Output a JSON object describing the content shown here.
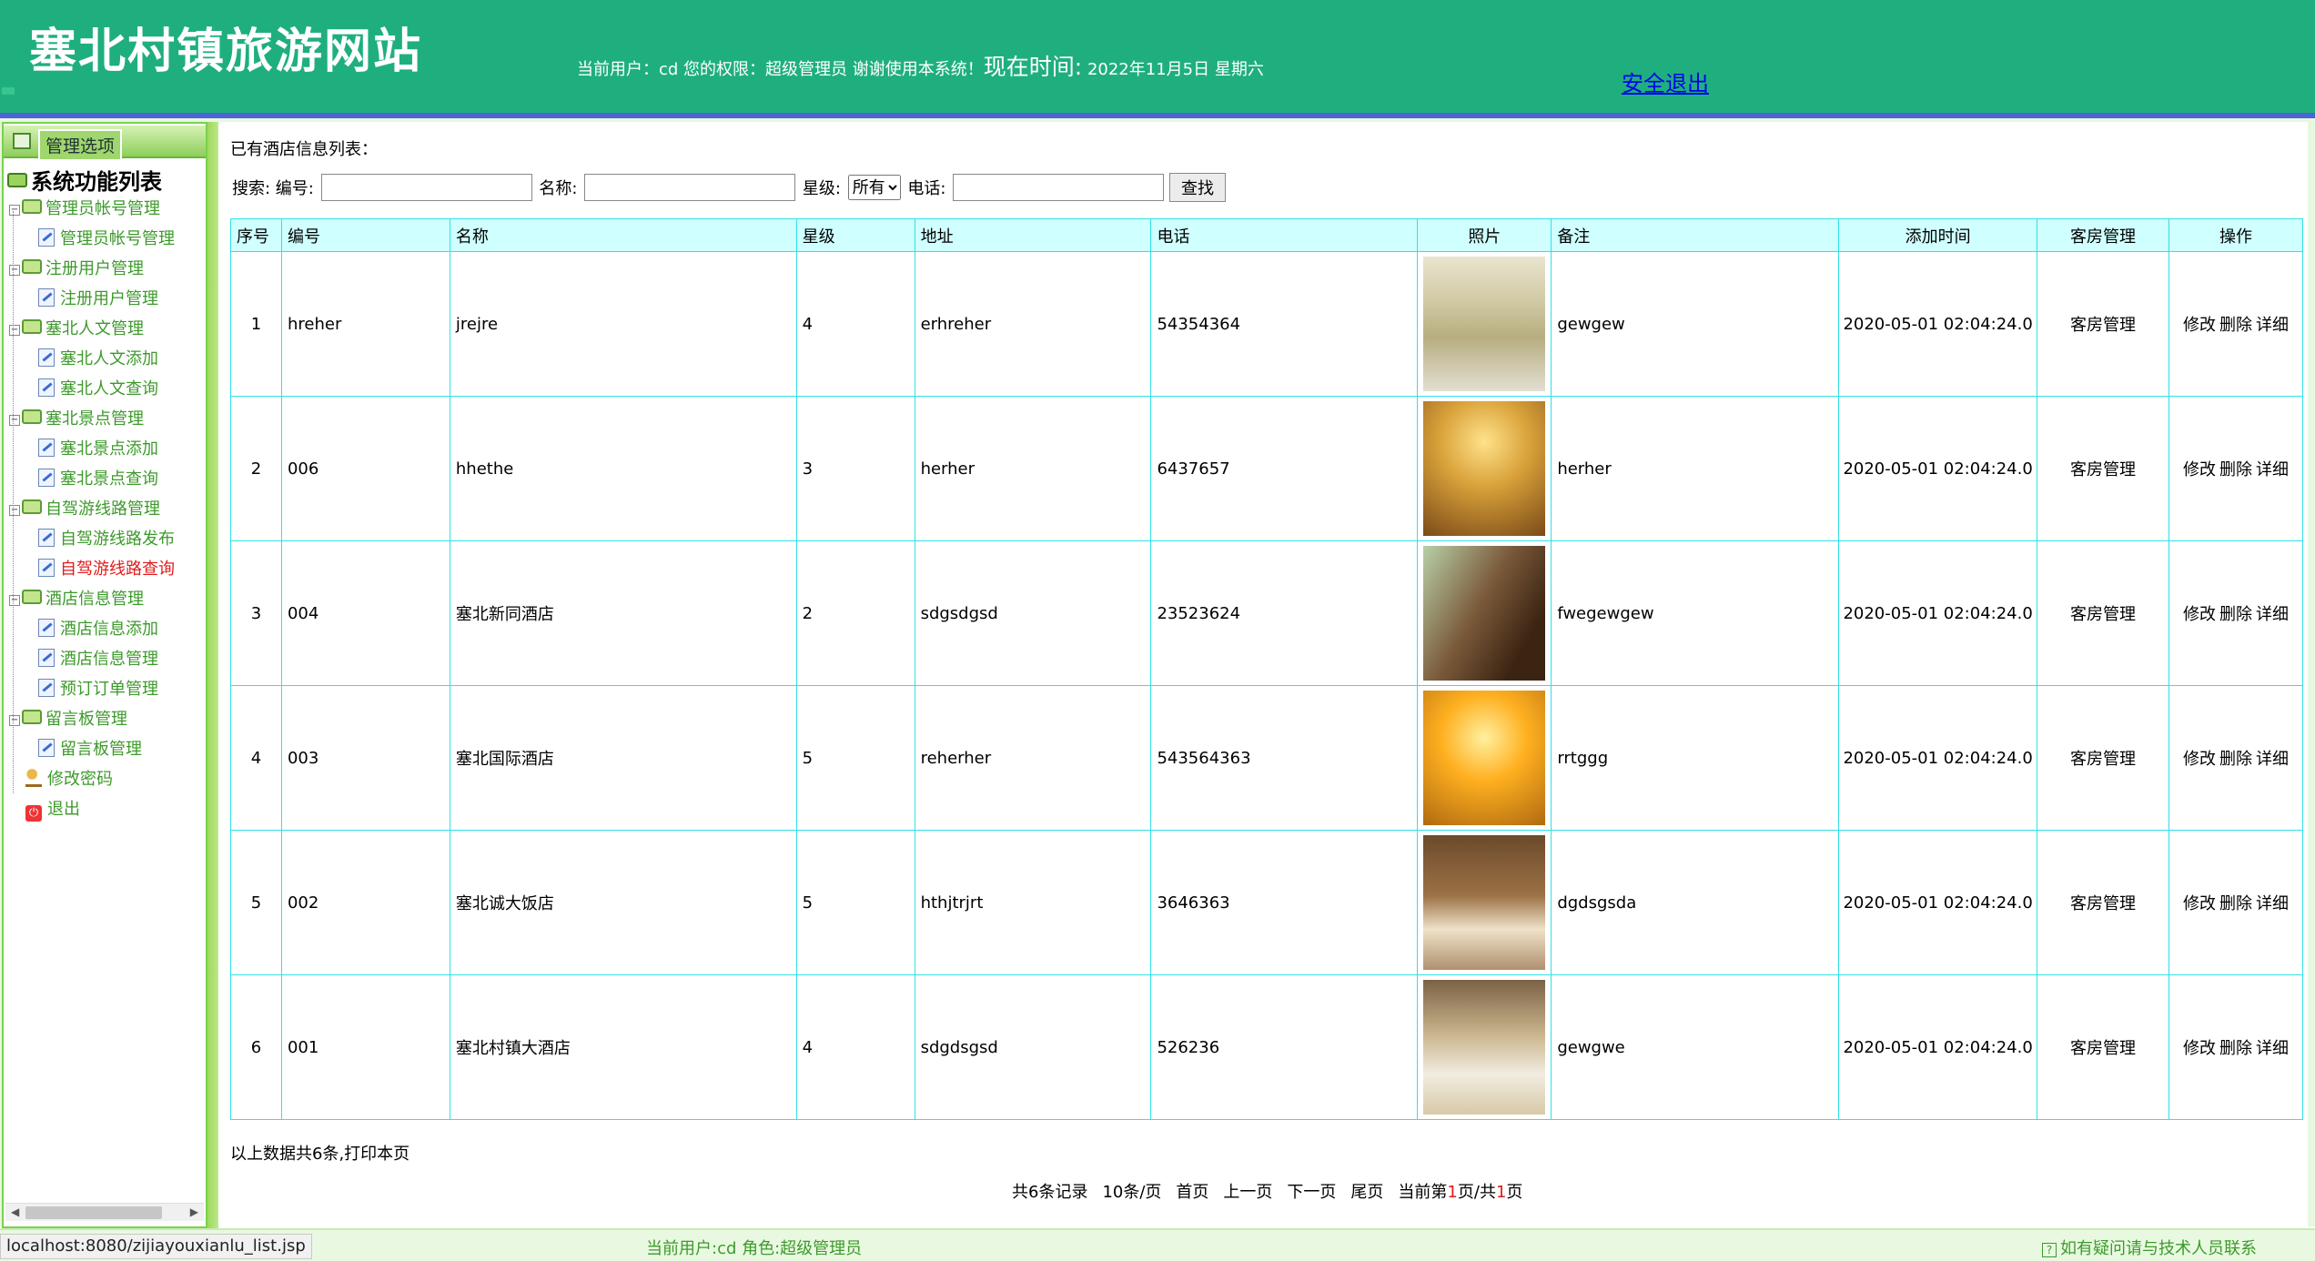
{
  "header": {
    "site_title": "塞北村镇旅游网站",
    "user_info": "当前用户：cd 您的权限：超级管理员 谢谢使用本系统！",
    "now_label": "现在时间:",
    "now_value": "2022年11月5日 星期六",
    "logout": "安全退出"
  },
  "sidebar": {
    "header_label": "管理选项",
    "title": "系统功能列表",
    "groups": [
      {
        "label": "管理员帐号管理",
        "items": [
          "管理员帐号管理"
        ]
      },
      {
        "label": "注册用户管理",
        "items": [
          "注册用户管理"
        ]
      },
      {
        "label": "塞北人文管理",
        "items": [
          "塞北人文添加",
          "塞北人文查询"
        ]
      },
      {
        "label": "塞北景点管理",
        "items": [
          "塞北景点添加",
          "塞北景点查询"
        ]
      },
      {
        "label": "自驾游线路管理",
        "items": [
          "自驾游线路发布",
          "自驾游线路查询"
        ]
      },
      {
        "label": "酒店信息管理",
        "items": [
          "酒店信息添加",
          "酒店信息管理",
          "预订订单管理"
        ]
      },
      {
        "label": "留言板管理",
        "items": [
          "留言板管理"
        ]
      }
    ],
    "change_password": "修改密码",
    "exit": "退出",
    "active_item": "自驾游线路查询"
  },
  "main": {
    "list_title": "已有酒店信息列表：",
    "search": {
      "label": "搜索: 编号:",
      "name_label": "名称:",
      "star_label": "星级:",
      "star_selected": "所有",
      "phone_label": "电话:",
      "button": "查找"
    },
    "columns": [
      "序号",
      "编号",
      "名称",
      "星级",
      "地址",
      "电话",
      "照片",
      "备注",
      "添加时间",
      "客房管理",
      "操作"
    ],
    "rows": [
      {
        "no": "1",
        "code": "hreher",
        "name": "jrejre",
        "star": "4",
        "address": "erhreher",
        "phone": "54354364",
        "note": "gewgew",
        "time": "2020-05-01 02:04:24.0",
        "room": "客房管理",
        "edit": "修改",
        "del": "删除",
        "detail": "详细"
      },
      {
        "no": "2",
        "code": "006",
        "name": "hhethe",
        "star": "3",
        "address": "herher",
        "phone": "6437657",
        "note": "herher",
        "time": "2020-05-01 02:04:24.0",
        "room": "客房管理",
        "edit": "修改",
        "del": "删除",
        "detail": "详细"
      },
      {
        "no": "3",
        "code": "004",
        "name": "塞北新同酒店",
        "star": "2",
        "address": "sdgsdgsd",
        "phone": "23523624",
        "note": "fwegewgew",
        "time": "2020-05-01 02:04:24.0",
        "room": "客房管理",
        "edit": "修改",
        "del": "删除",
        "detail": "详细"
      },
      {
        "no": "4",
        "code": "003",
        "name": "塞北国际酒店",
        "star": "5",
        "address": "reherher",
        "phone": "543564363",
        "note": "rrtggg",
        "time": "2020-05-01 02:04:24.0",
        "room": "客房管理",
        "edit": "修改",
        "del": "删除",
        "detail": "详细"
      },
      {
        "no": "5",
        "code": "002",
        "name": "塞北诚大饭店",
        "star": "5",
        "address": "hthjtrjrt",
        "phone": "3646363",
        "note": "dgdsgsda",
        "time": "2020-05-01 02:04:24.0",
        "room": "客房管理",
        "edit": "修改",
        "del": "删除",
        "detail": "详细"
      },
      {
        "no": "6",
        "code": "001",
        "name": "塞北村镇大酒店",
        "star": "4",
        "address": "sdgdsgsd",
        "phone": "526236",
        "note": "gewgwe",
        "time": "2020-05-01 02:04:24.0",
        "room": "客房管理",
        "edit": "修改",
        "del": "删除",
        "detail": "详细"
      }
    ],
    "footer_note": "以上数据共6条,打印本页",
    "pager": {
      "total": "共6条记录",
      "per_page": "10条/页",
      "first": "首页",
      "prev": "上一页",
      "next": "下一页",
      "last": "尾页",
      "current_prefix": "当前第",
      "current_page": "1",
      "current_mid": "页/共",
      "total_pages": "1",
      "current_suffix": "页"
    }
  },
  "statusbar": {
    "url": "localhost:8080/zijiayouxianlu_list.jsp",
    "user": "当前用户:cd  角色:超级管理员",
    "help": "如有疑问请与技术人员联系"
  }
}
